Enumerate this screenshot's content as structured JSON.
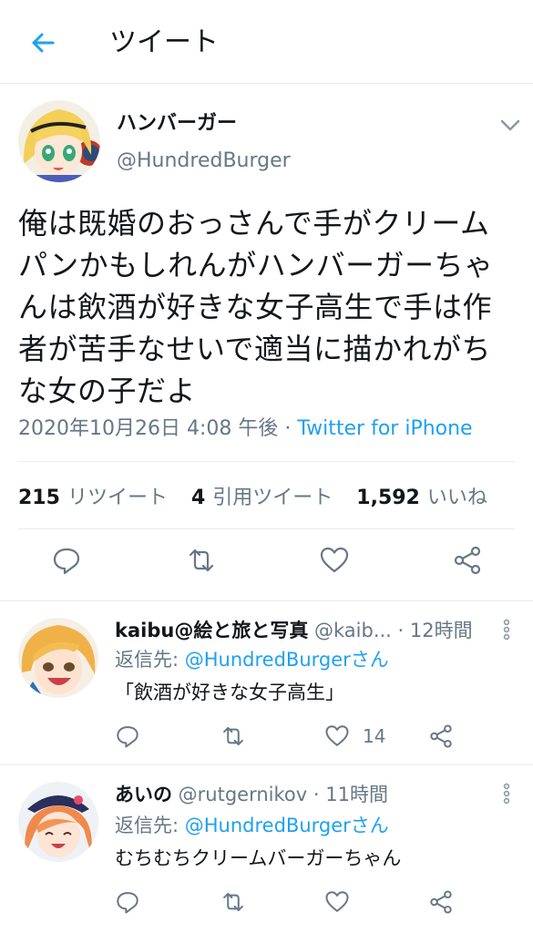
{
  "header": {
    "title": "ツイート",
    "back_icon": "arrow-left-icon",
    "accent": "#1da1f2"
  },
  "tweet": {
    "author_name": "ハンバーガー",
    "author_handle": "@HundredBurger",
    "text_lines": [
      "俺は既婚のおっさんで手がクリーム",
      "パンかもしれんがハンバーガーちゃ",
      "んは飲酒が好きな女子高生で手は作",
      "者が苦手なせいで適当に描かれがち",
      "な女の子だよ"
    ],
    "timestamp": "2020年10月26日 4:08 午後",
    "separator": " · ",
    "source": "Twitter for iPhone",
    "retweets_count": "215",
    "retweets_label": "リツイート",
    "quotes_count": "4",
    "quotes_label": "引用ツイート",
    "likes_count": "1,592",
    "likes_label": "いいね"
  },
  "replies": [
    {
      "name": "kaibu@絵と旅と写真",
      "handle_time": " @kaib... · 12時間",
      "reply_to_label": "返信先: ",
      "reply_to_mention": "@HundredBurgerさん",
      "text": "「飲酒が好きな女子高生」",
      "like_count": "14"
    },
    {
      "name": "あいの",
      "handle_time": " @rutgernikov · 11時間",
      "reply_to_label": "返信先: ",
      "reply_to_mention": "@HundredBurgerさん",
      "text": "むちむちクリームバーガーちゃん",
      "like_count": ""
    }
  ],
  "colors": {
    "text": "#14171a",
    "secondary": "#657786",
    "link": "#1da1f2",
    "divider": "#e6ecf0"
  }
}
